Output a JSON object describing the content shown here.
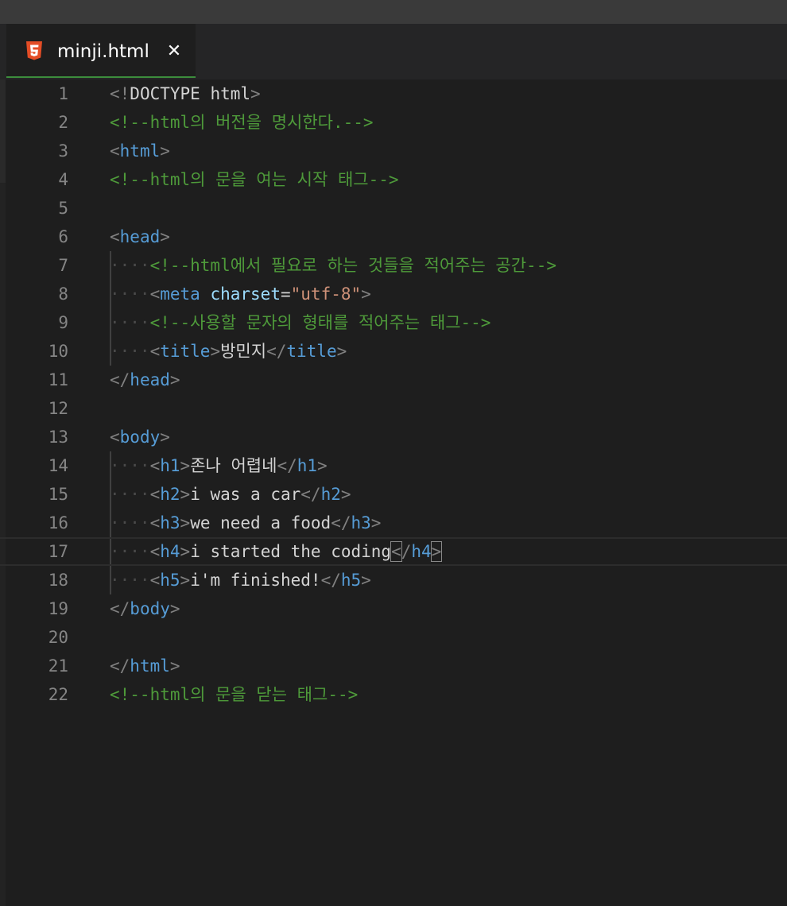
{
  "tab": {
    "filename": "minji.html",
    "close_glyph": "✕",
    "icon": "html5-icon"
  },
  "editor": {
    "cursor_line": 17,
    "lines": [
      {
        "num": "1",
        "tokens": [
          [
            "punc",
            "<!"
          ],
          [
            "text",
            "DOCTYPE html"
          ],
          [
            "punc",
            ">"
          ]
        ]
      },
      {
        "num": "2",
        "tokens": [
          [
            "cmt",
            "<!--html의 버전을 명시한다.-->"
          ]
        ]
      },
      {
        "num": "3",
        "tokens": [
          [
            "punc",
            "<"
          ],
          [
            "tag",
            "html"
          ],
          [
            "punc",
            ">"
          ]
        ]
      },
      {
        "num": "4",
        "tokens": [
          [
            "cmt",
            "<!--html의 문을 여는 시작 태그-->"
          ]
        ]
      },
      {
        "num": "5",
        "tokens": []
      },
      {
        "num": "6",
        "tokens": [
          [
            "punc",
            "<"
          ],
          [
            "tag",
            "head"
          ],
          [
            "punc",
            ">"
          ]
        ]
      },
      {
        "num": "7",
        "tokens": [
          [
            "ws",
            "····"
          ],
          [
            "cmt",
            "<!--html에서 필요로 하는 것들을 적어주는 공간-->"
          ]
        ]
      },
      {
        "num": "8",
        "tokens": [
          [
            "ws",
            "····"
          ],
          [
            "punc",
            "<"
          ],
          [
            "tag",
            "meta"
          ],
          [
            "text",
            " "
          ],
          [
            "attr",
            "charset"
          ],
          [
            "text",
            "="
          ],
          [
            "str",
            "\"utf-8\""
          ],
          [
            "punc",
            ">"
          ]
        ]
      },
      {
        "num": "9",
        "tokens": [
          [
            "ws",
            "····"
          ],
          [
            "cmt",
            "<!--사용할 문자의 형태를 적어주는 태그-->"
          ]
        ]
      },
      {
        "num": "10",
        "tokens": [
          [
            "ws",
            "····"
          ],
          [
            "punc",
            "<"
          ],
          [
            "tag",
            "title"
          ],
          [
            "punc",
            ">"
          ],
          [
            "text",
            "방민지"
          ],
          [
            "punc",
            "</"
          ],
          [
            "tag",
            "title"
          ],
          [
            "punc",
            ">"
          ]
        ]
      },
      {
        "num": "11",
        "tokens": [
          [
            "punc",
            "</"
          ],
          [
            "tag",
            "head"
          ],
          [
            "punc",
            ">"
          ]
        ]
      },
      {
        "num": "12",
        "tokens": []
      },
      {
        "num": "13",
        "tokens": [
          [
            "punc",
            "<"
          ],
          [
            "tag",
            "body"
          ],
          [
            "punc",
            ">"
          ]
        ]
      },
      {
        "num": "14",
        "tokens": [
          [
            "ws",
            "····"
          ],
          [
            "punc",
            "<"
          ],
          [
            "tag",
            "h1"
          ],
          [
            "punc",
            ">"
          ],
          [
            "text",
            "존나 어렵네"
          ],
          [
            "punc",
            "</"
          ],
          [
            "tag",
            "h1"
          ],
          [
            "punc",
            ">"
          ]
        ]
      },
      {
        "num": "15",
        "tokens": [
          [
            "ws",
            "····"
          ],
          [
            "punc",
            "<"
          ],
          [
            "tag",
            "h2"
          ],
          [
            "punc",
            ">"
          ],
          [
            "text",
            "i was a car"
          ],
          [
            "punc",
            "</"
          ],
          [
            "tag",
            "h2"
          ],
          [
            "punc",
            ">"
          ]
        ]
      },
      {
        "num": "16",
        "tokens": [
          [
            "ws",
            "····"
          ],
          [
            "punc",
            "<"
          ],
          [
            "tag",
            "h3"
          ],
          [
            "punc",
            ">"
          ],
          [
            "text",
            "we need a food"
          ],
          [
            "punc",
            "</"
          ],
          [
            "tag",
            "h3"
          ],
          [
            "punc",
            ">"
          ]
        ]
      },
      {
        "num": "17",
        "tokens": [
          [
            "ws",
            "····"
          ],
          [
            "punc",
            "<"
          ],
          [
            "tag",
            "h4"
          ],
          [
            "punc",
            ">"
          ],
          [
            "text",
            "i started the coding"
          ],
          [
            "punc",
            "<",
            true
          ],
          [
            "punc",
            "/"
          ],
          [
            "tag",
            "h4"
          ],
          [
            "punc",
            ">",
            true
          ]
        ]
      },
      {
        "num": "18",
        "tokens": [
          [
            "ws",
            "····"
          ],
          [
            "punc",
            "<"
          ],
          [
            "tag",
            "h5"
          ],
          [
            "punc",
            ">"
          ],
          [
            "text",
            "i'm finished!"
          ],
          [
            "punc",
            "</"
          ],
          [
            "tag",
            "h5"
          ],
          [
            "punc",
            ">"
          ]
        ]
      },
      {
        "num": "19",
        "tokens": [
          [
            "punc",
            "</"
          ],
          [
            "tag",
            "body"
          ],
          [
            "punc",
            ">"
          ]
        ]
      },
      {
        "num": "20",
        "tokens": []
      },
      {
        "num": "21",
        "tokens": [
          [
            "punc",
            "</"
          ],
          [
            "tag",
            "html"
          ],
          [
            "punc",
            ">"
          ]
        ]
      },
      {
        "num": "22",
        "tokens": [
          [
            "cmt",
            "<!--html의 문을 닫는 태그-->"
          ]
        ]
      }
    ]
  },
  "colors": {
    "background": "#1e1e1e",
    "tag": "#569cd6",
    "attribute": "#9cdcfe",
    "string": "#ce9178",
    "comment": "#4e9a3a",
    "punctuation": "#808080",
    "line_number": "#858585",
    "active_tab_border": "#3c8d3c",
    "html5_icon": "#e44d26"
  }
}
